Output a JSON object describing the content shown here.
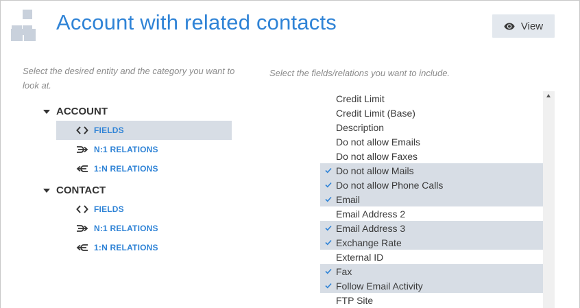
{
  "header": {
    "title": "Account with related contacts",
    "view_label": "View"
  },
  "left_hint": "Select the desired entity and the category you want to look at.",
  "right_hint": "Select the fields/relations you want to include.",
  "tree": [
    {
      "entity": "ACCOUNT",
      "items": [
        {
          "label": "FIELDS",
          "icon": "code-brackets-icon",
          "selected": true
        },
        {
          "label": "N:1 RELATIONS",
          "icon": "merge-arrow-icon",
          "selected": false
        },
        {
          "label": "1:N RELATIONS",
          "icon": "split-arrow-icon",
          "selected": false
        }
      ]
    },
    {
      "entity": "CONTACT",
      "items": [
        {
          "label": "FIELDS",
          "icon": "code-brackets-icon",
          "selected": false
        },
        {
          "label": "N:1 RELATIONS",
          "icon": "merge-arrow-icon",
          "selected": false
        },
        {
          "label": "1:N RELATIONS",
          "icon": "split-arrow-icon",
          "selected": false
        }
      ]
    }
  ],
  "fields": [
    {
      "label": "Credit Limit",
      "checked": false
    },
    {
      "label": "Credit Limit (Base)",
      "checked": false
    },
    {
      "label": "Description",
      "checked": false
    },
    {
      "label": "Do not allow Emails",
      "checked": false
    },
    {
      "label": "Do not allow Faxes",
      "checked": false
    },
    {
      "label": "Do not allow Mails",
      "checked": true
    },
    {
      "label": "Do not allow Phone Calls",
      "checked": true
    },
    {
      "label": "Email",
      "checked": true
    },
    {
      "label": "Email Address 2",
      "checked": false
    },
    {
      "label": "Email Address 3",
      "checked": true
    },
    {
      "label": "Exchange Rate",
      "checked": true
    },
    {
      "label": "External ID",
      "checked": false
    },
    {
      "label": "Fax",
      "checked": true
    },
    {
      "label": "Follow Email Activity",
      "checked": true
    },
    {
      "label": "FTP Site",
      "checked": false
    }
  ],
  "colors": {
    "accent": "#2f83d6",
    "selected_bg": "#d7dde5",
    "button_bg": "#e3e8ee"
  }
}
